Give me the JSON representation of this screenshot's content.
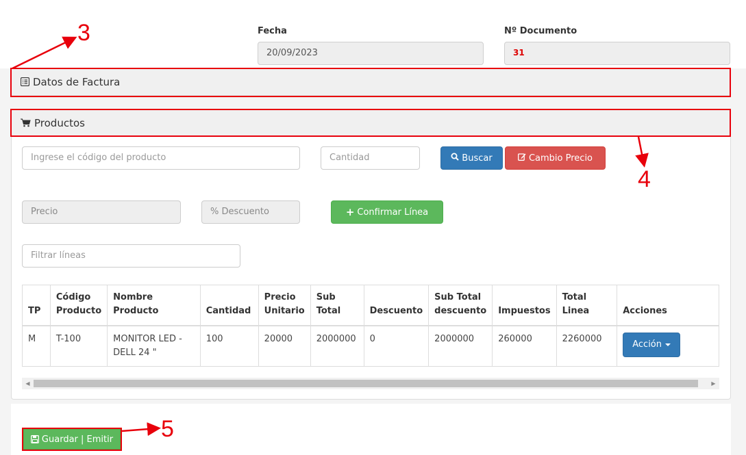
{
  "header": {
    "fecha_label": "Fecha",
    "fecha_value": "20/09/2023",
    "doc_label": "Nº Documento",
    "doc_value": "31"
  },
  "datos_factura": {
    "title": "Datos de Factura",
    "icon": "list-alt-icon"
  },
  "productos": {
    "title": "Productos",
    "icon": "shopping-cart-icon",
    "codigo_placeholder": "Ingrese el código del producto",
    "cantidad_placeholder": "Cantidad",
    "buscar_label": "Buscar",
    "cambio_precio_label": "Cambio Precio",
    "precio_placeholder": "Precio",
    "descuento_placeholder": "% Descuento",
    "confirmar_label": "Confirmar Línea",
    "filtrar_placeholder": "Filtrar líneas"
  },
  "table": {
    "headers": {
      "tp": "TP",
      "codigo_1": "Código",
      "codigo_2": "Producto",
      "nombre_1": "Nombre",
      "nombre_2": "Producto",
      "cantidad": "Cantidad",
      "precio_1": "Precio",
      "precio_2": "Unitario",
      "subtotal_1": "Sub",
      "subtotal_2": "Total",
      "descuento": "Descuento",
      "subtotaldesc_1": "Sub Total",
      "subtotaldesc_2": "descuento",
      "impuestos": "Impuestos",
      "total_1": "Total",
      "total_2": "Linea",
      "acciones": "Acciones"
    },
    "rows": [
      {
        "tp": "M",
        "codigo": "T-100",
        "nombre": "MONITOR LED - DELL 24 \"",
        "cantidad": "100",
        "precio": "20000",
        "subtotal": "2000000",
        "descuento": "0",
        "subtotal_desc": "2000000",
        "impuestos": "260000",
        "total": "2260000",
        "accion_label": "Acción"
      }
    ]
  },
  "footer": {
    "save_label": "Guardar | Emitir",
    "save_icon": "floppy-disk-icon"
  },
  "annotations": {
    "n3": "3",
    "n4": "4",
    "n5": "5"
  },
  "colors": {
    "annotation": "#e8000b",
    "primary": "#337ab7",
    "danger": "#d9534f",
    "success": "#5cb85c"
  }
}
